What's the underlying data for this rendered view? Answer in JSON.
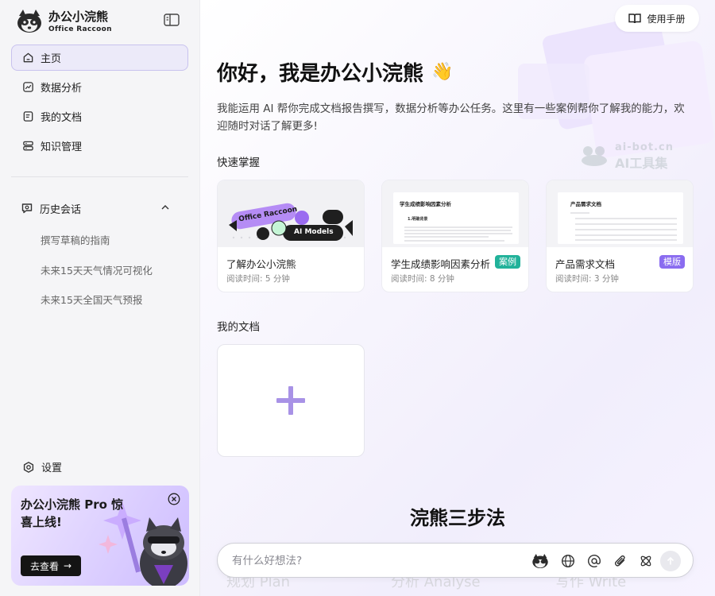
{
  "brand": {
    "name": "办公小浣熊",
    "subtitle": "Office Raccoon"
  },
  "nav": {
    "home": "主页",
    "data_analysis": "数据分析",
    "my_docs": "我的文档",
    "knowledge": "知识管理"
  },
  "history": {
    "title": "历史会话",
    "items": [
      "撰写草稿的指南",
      "未来15天天气情况可视化",
      "未来15天全国天气预报"
    ]
  },
  "settings_label": "设置",
  "promo": {
    "title": "办公小浣熊 Pro 惊喜上线!",
    "button": "去查看"
  },
  "header": {
    "manual": "使用手册"
  },
  "main": {
    "greeting": "你好，我是办公小浣熊",
    "wave": "👋",
    "intro": "我能运用 AI 帮你完成文档报告撰写，数据分析等办公任务。这里有一些案例帮你了解我的能力，欢迎随时对话了解更多!",
    "quick_title": "快速掌握",
    "my_docs_title": "我的文档",
    "three_steps": "浣熊三步法"
  },
  "watermark": {
    "line1": "ai-bot.cn",
    "line2": "AI工具集"
  },
  "cards": [
    {
      "title": "了解办公小浣熊",
      "meta": "阅读时间: 5 分钟",
      "badge": "",
      "thumb_tag": "Office Raccoon",
      "thumb_tag2": "AI Models"
    },
    {
      "title": "学生成绩影响因素分析",
      "meta": "阅读时间: 8 分钟",
      "badge": "案例",
      "thumb_heading": "学生成绩影响因素分析",
      "thumb_sub": "1.明确背景"
    },
    {
      "title": "产品需求文档",
      "meta": "阅读时间: 3 分钟",
      "badge": "模版",
      "thumb_heading": "产品需求文档"
    }
  ],
  "ghost_steps": [
    "规划 Plan",
    "分析 Analyse",
    "写作 Write"
  ],
  "chat": {
    "placeholder": "有什么好想法?"
  },
  "colors": {
    "accent": "#8a6cf0",
    "case_badge": "#21b29a",
    "promo_bg": "#dfd3ff"
  }
}
